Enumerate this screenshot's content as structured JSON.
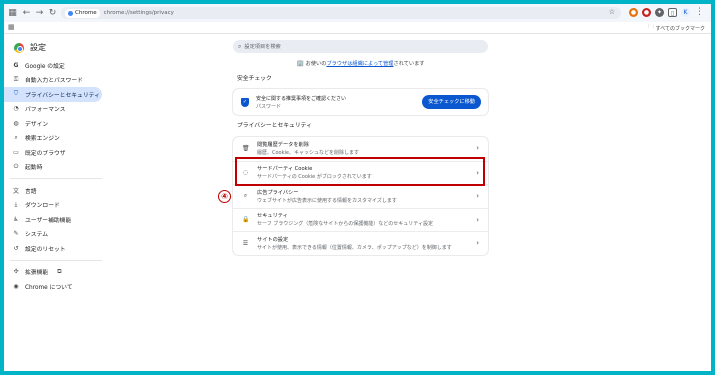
{
  "browser": {
    "url_chip": "Chrome",
    "url": "chrome://settings/privacy",
    "bookmarks_all": "すべてのブックマーク"
  },
  "settings_title": "設定",
  "sidebar": {
    "items": [
      {
        "label": "Google の設定",
        "icon": "google-icon"
      },
      {
        "label": "自動入力とパスワード",
        "icon": "key-icon"
      },
      {
        "label": "プライバシーとセキュリティ",
        "icon": "shield-icon",
        "active": true
      },
      {
        "label": "パフォーマンス",
        "icon": "gauge-icon"
      },
      {
        "label": "デザイン",
        "icon": "palette-icon"
      },
      {
        "label": "検索エンジン",
        "icon": "search-icon"
      },
      {
        "label": "既定のブラウザ",
        "icon": "browser-icon"
      },
      {
        "label": "起動時",
        "icon": "power-icon"
      }
    ],
    "items2": [
      {
        "label": "言語",
        "icon": "translate-icon"
      },
      {
        "label": "ダウンロード",
        "icon": "download-icon"
      },
      {
        "label": "ユーザー補助機能",
        "icon": "accessibility-icon"
      },
      {
        "label": "システム",
        "icon": "wrench-icon"
      },
      {
        "label": "設定のリセット",
        "icon": "reset-icon"
      }
    ],
    "items3": [
      {
        "label": "拡張機能",
        "icon": "puzzle-icon"
      },
      {
        "label": "Chrome について",
        "icon": "chrome-icon"
      }
    ]
  },
  "search": {
    "placeholder": "設定項目を検索"
  },
  "managed": {
    "pre": "お使いの",
    "link": "ブラウザは組織によって管理",
    "post": "されています"
  },
  "safety_check": {
    "heading": "安全チェック",
    "line1": "安全に関する推奨事項をご確認ください",
    "line2": "パスワード",
    "button": "安全チェックに移動"
  },
  "privacy": {
    "heading": "プライバシーとセキュリティ",
    "rows": [
      {
        "title": "閲覧履歴データを削除",
        "desc": "履歴、Cookie、キャッシュなどを削除します",
        "icon": "trash-icon"
      },
      {
        "title": "サードパーティ Cookie",
        "desc": "サードパーティの Cookie がブロックされています",
        "icon": "cookie-icon"
      },
      {
        "title": "広告プライバシー",
        "desc": "ウェブサイトが広告表示に使用する情報をカスタマイズします",
        "icon": "ad-privacy-icon"
      },
      {
        "title": "セキュリティ",
        "desc": "セーフ ブラウジング（危険なサイトからの保護機能）などのセキュリティ設定",
        "icon": "lock-icon"
      },
      {
        "title": "サイトの設定",
        "desc": "サイトが使用、表示できる情報（位置情報、カメラ、ポップアップなど）を制御します",
        "icon": "sliders-icon"
      }
    ]
  },
  "annotation": {
    "badge": "④",
    "color": "#c00000"
  }
}
